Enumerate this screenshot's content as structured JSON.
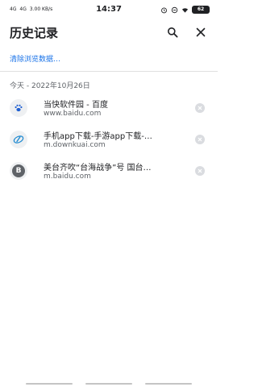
{
  "status_bar": {
    "left_text": [
      "4G",
      "4G",
      "3.00 KB/s"
    ],
    "time": "14:37",
    "battery": "62"
  },
  "header": {
    "title": "历史记录"
  },
  "actions": {
    "clear_label": "清除浏览数据…"
  },
  "history": {
    "date_label": "今天 - 2022年10月26日",
    "items": [
      {
        "title": "当快软件园 - 百度",
        "url": "www.baidu.com",
        "icon": "paw-icon"
      },
      {
        "title": "手机app下载-手游app下载-…",
        "url": "m.downkuai.com",
        "icon": "downkuai-icon"
      },
      {
        "title": "美台齐吹“台海战争”号 国台…",
        "url": "m.baidu.com",
        "icon": "letter-b-icon",
        "icon_letter": "B"
      }
    ]
  },
  "colors": {
    "link": "#1a73e8",
    "accent_icon": "#1f5fd1",
    "text_primary": "#202124",
    "text_secondary": "#5f6368"
  }
}
